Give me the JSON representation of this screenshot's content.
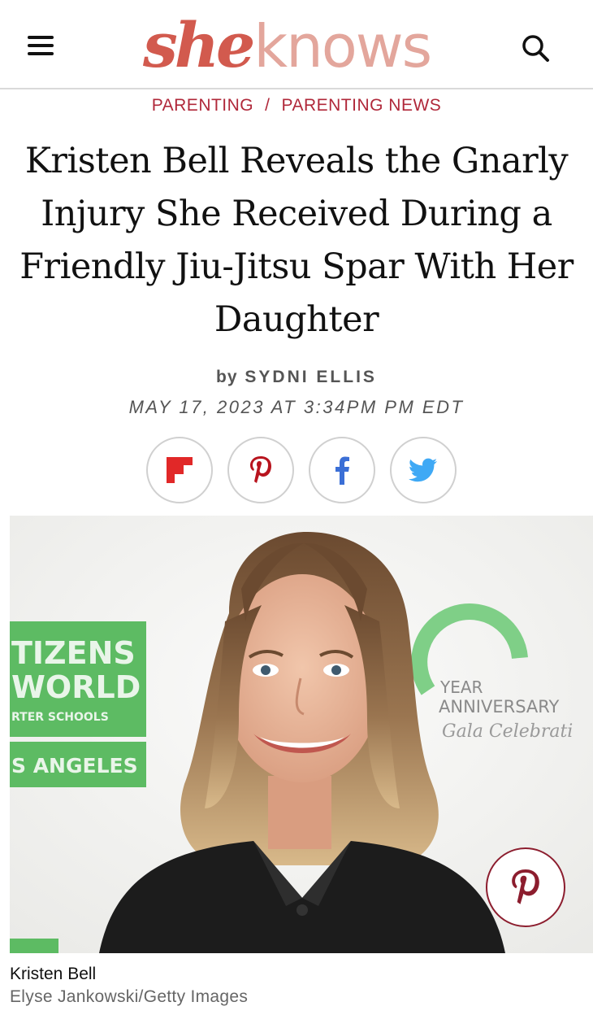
{
  "header": {
    "logo_she": "she",
    "logo_knows": "knows",
    "menu_icon": "hamburger-menu-icon",
    "search_icon": "search-icon",
    "accent_color": "#d25a4e"
  },
  "breadcrumb": {
    "items": [
      "PARENTING",
      "PARENTING NEWS"
    ],
    "separator": "/",
    "color": "#b0283a"
  },
  "article": {
    "headline": "Kristen Bell Reveals the Gnarly Injury She Received During a Friendly Jiu-Jitsu Spar With Her Daughter",
    "by_label": "by",
    "author": "SYDNI ELLIS",
    "date": "MAY 17, 2023 AT 3:34PM PM EDT"
  },
  "share": {
    "buttons": [
      {
        "name": "flipboard",
        "icon": "flipboard-icon",
        "color": "#e12828"
      },
      {
        "name": "pinterest",
        "icon": "pinterest-icon",
        "color": "#b8141e"
      },
      {
        "name": "facebook",
        "icon": "facebook-icon",
        "color": "#3b6fd6"
      },
      {
        "name": "twitter",
        "icon": "twitter-icon",
        "color": "#3fa9f5"
      }
    ]
  },
  "hero": {
    "backdrop_left_text": [
      "TIZENS",
      "WORLD",
      "RTER SCHOOLS",
      "S ANGELES"
    ],
    "backdrop_right_text": [
      "YEAR",
      "ANNIVERSARY",
      "Gala Celebrati"
    ],
    "pin_icon": "pinterest-icon"
  },
  "caption": {
    "title": "Kristen Bell",
    "credit": "Elyse Jankowski/Getty Images"
  }
}
